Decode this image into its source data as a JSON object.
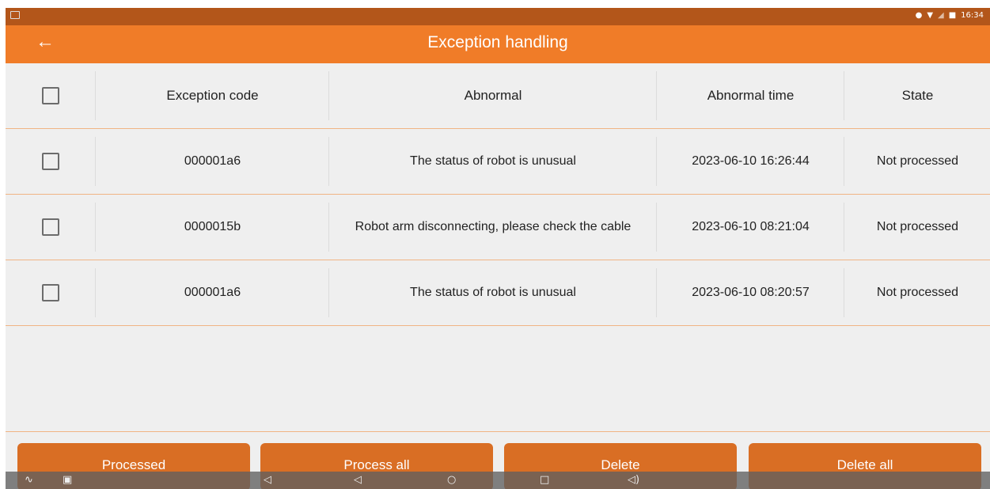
{
  "status_bar": {
    "time": "16:34",
    "icons": [
      "screen-icon",
      "location-icon",
      "wifi-icon",
      "signal-icon",
      "battery-icon"
    ]
  },
  "app_bar": {
    "title": "Exception handling",
    "back_icon": "arrow-left-icon"
  },
  "table": {
    "headers": {
      "code": "Exception code",
      "abnormal": "Abnormal",
      "time": "Abnormal time",
      "state": "State"
    },
    "rows": [
      {
        "code": "000001a6",
        "abnormal": "The status of robot is unusual",
        "time": "2023-06-10 16:26:44",
        "state": "Not processed"
      },
      {
        "code": "0000015b",
        "abnormal": "Robot arm disconnecting, please check the cable",
        "time": "2023-06-10 08:21:04",
        "state": "Not processed"
      },
      {
        "code": "000001a6",
        "abnormal": "The status of robot is unusual",
        "time": "2023-06-10 08:20:57",
        "state": "Not processed"
      }
    ]
  },
  "actions": {
    "processed": "Processed",
    "process_all": "Process all",
    "delete": "Delete",
    "delete_all": "Delete all"
  },
  "nav_bar": {
    "icons": [
      "chevron-down-icon",
      "screenshot-icon",
      "volume-down-icon",
      "back-icon",
      "home-icon",
      "recents-icon",
      "volume-up-icon"
    ]
  },
  "colors": {
    "accent": "#f07c28",
    "status_bar": "#b3561a",
    "button": "#d96e24",
    "state_text": "#c0392b",
    "divider": "#f0b484"
  }
}
